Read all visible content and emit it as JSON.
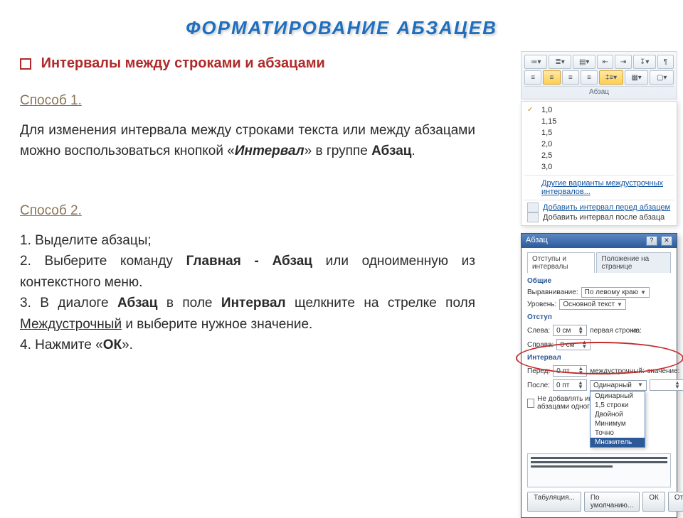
{
  "title": "ФОРМАТИРОВАНИЕ  АБЗАЦЕВ",
  "heading": "Интервалы  между  строками  и  абзацами",
  "method1": {
    "label": "Способ 1.",
    "text_a": "Для изменения интервала между строками текста или между абзацами можно воспользоваться кнопкой «",
    "text_b": "Интервал",
    "text_c": "» в группе ",
    "text_d": "Абзац",
    "text_e": "."
  },
  "method2": {
    "label": "Способ 2.",
    "line1": "1. Выделите  абзацы;",
    "line2a": "2. Выберите  команду   ",
    "line2b": "Главная - Абзац",
    "line2c": "  или одноименную из контекстного  меню.",
    "line3a": "3. В диалоге  ",
    "line3b": "Абзац",
    "line3c": "  в поле  ",
    "line3d": "Интервал",
    "line3e": "  щелкните  на стрелке поля  ",
    "line3f": "Междустрочный",
    "line3g": "  и  выберите  нужное  значение.",
    "line4a": "4. Нажмите «",
    "line4b": "ОК",
    "line4c": "»."
  },
  "ribbon": {
    "group_label": "Абзац"
  },
  "spacing_menu": {
    "items": [
      "1,0",
      "1,15",
      "1,5",
      "2,0",
      "2,5",
      "3,0"
    ],
    "checked": 0,
    "more": "Другие варианты междустрочных интервалов...",
    "add_before": "Добавить интервал перед абзацем",
    "add_after": "Добавить интервал после абзаца"
  },
  "dialog": {
    "title": "Абзац",
    "tabs": [
      "Отступы и интервалы",
      "Положение на странице"
    ],
    "general": "Общие",
    "alignment_label": "Выравнивание:",
    "alignment_value": "По левому краю",
    "level_label": "Уровень:",
    "level_value": "Основной текст",
    "indent_section": "Отступ",
    "left_label": "Слева:",
    "left_value": "0 см",
    "right_label": "Справа:",
    "right_value": "0 см",
    "firstline_label": "первая строка:",
    "firstline_on_label": "на:",
    "spacing_section": "Интервал",
    "before_label": "Перед:",
    "before_value": "0 пт",
    "after_label": "После:",
    "after_value": "0 пт",
    "linespacing_label": "междустрочный:",
    "linespacing_value": "Одинарный",
    "linespacing_on_label": "значение:",
    "dont_add": "Не добавлять интервал между абзацами одного стиля",
    "combo_options": [
      "Одинарный",
      "1,5 строки",
      "Двойной",
      "Минимум",
      "Точно",
      "Множитель"
    ],
    "btn_tabs": "Табуляция...",
    "btn_default": "По умолчанию...",
    "btn_ok": "ОК",
    "btn_cancel": "Отмена"
  }
}
